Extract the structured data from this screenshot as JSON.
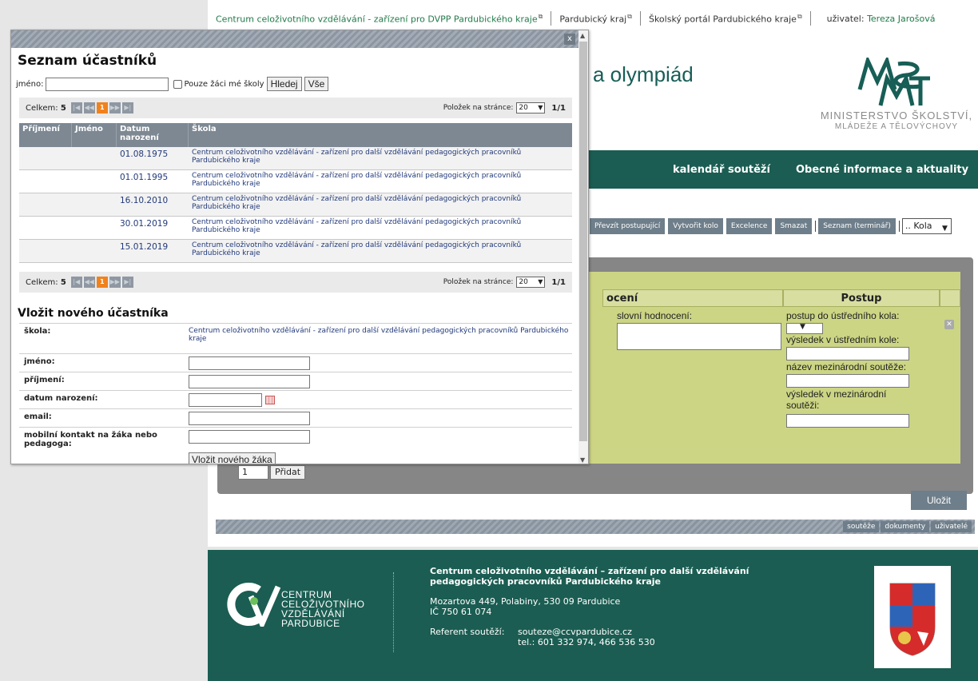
{
  "topbar": {
    "links": [
      {
        "label": "Centrum celoživotního vzdělávání - zařízení pro DVPP Pardubického kraje",
        "external": true
      },
      {
        "label": "Pardubický kraj",
        "external": true
      },
      {
        "label": "Školský portál Pardubického kraje",
        "external": true
      }
    ],
    "user_label": "uživatel:",
    "user_name": "Tereza Jarošová"
  },
  "header": {
    "title_fragment": "a olympiád",
    "ministry_line1": "MINISTERSTVO ŠKOLSTVÍ,",
    "ministry_line2": "MLÁDEŽE A TĚLOVÝCHOVY"
  },
  "nav": {
    "items": [
      "kalendář soutěží",
      "Obecné informace a aktuality"
    ]
  },
  "toolbar": {
    "buttons": [
      "Převzít postupující",
      "Vytvořit kolo",
      "Excelence",
      "Smazat",
      "Seznam (terminář)"
    ],
    "round_select": ".. Kola"
  },
  "result_panel": {
    "col_hodnoceni": "ocení",
    "col_postup": "Postup",
    "slovni_label": "slovní hodnocení:",
    "postup_label": "postup do ústředního kola:",
    "vysledek_ustredni_label": "výsledek v ústředním kole:",
    "nazev_mezinarodni_label": "název mezinárodní soutěže:",
    "vysledek_mezinarodni_label": "výsledek v mezinárodní soutěži:",
    "count_select": "1",
    "pridat_button": "Přidat",
    "save_button": "Uložit"
  },
  "bottombar": {
    "links": [
      "soutěže",
      "dokumenty",
      "uživatelé"
    ]
  },
  "footer": {
    "logo_lines": [
      "CENTRUM",
      "CELOŽIVOTNÍHO",
      "VZDĚLÁVÁNÍ",
      "PARDUBICE"
    ],
    "org_name": "Centrum celoživotního vzdělávání – zařízení pro další vzdělávání pedagogických pracovníků Pardubického kraje",
    "address": "Mozartova 449, Polabiny, 530 09 Pardubice",
    "ico": "IČ 750 61 074",
    "referent_label": "Referent soutěží:",
    "email": "souteze@ccvpardubice.cz",
    "phone": "tel.: 601 332 974, 466 536 530"
  },
  "modal": {
    "close_label": "x",
    "title": "Seznam účastníků",
    "filter": {
      "name_label": "jméno:",
      "name_value": "",
      "only_my_school_label": "Pouze žáci mé školy",
      "search_button": "Hledej",
      "all_button": "Vše"
    },
    "pager": {
      "total_label": "Celkem:",
      "total_value": "5",
      "current_page": "1",
      "per_page_label": "Položek na stránce:",
      "per_page_value": "20",
      "page_info": "1/1"
    },
    "table": {
      "headers": [
        "Příjmení",
        "Jméno",
        "Datum narození",
        "Škola"
      ],
      "rows": [
        {
          "prijmeni": "",
          "jmeno": "",
          "datum": "01.08.1975",
          "skola": "Centrum celoživotního vzdělávání - zařízení pro další vzdělávání pedagogických pracovníků Pardubického kraje"
        },
        {
          "prijmeni": "",
          "jmeno": "",
          "datum": "01.01.1995",
          "skola": "Centrum celoživotního vzdělávání - zařízení pro další vzdělávání pedagogických pracovníků Pardubického kraje"
        },
        {
          "prijmeni": "",
          "jmeno": "",
          "datum": "16.10.2010",
          "skola": "Centrum celoživotního vzdělávání - zařízení pro další vzdělávání pedagogických pracovníků Pardubického kraje"
        },
        {
          "prijmeni": "",
          "jmeno": "",
          "datum": "30.01.2019",
          "skola": "Centrum celoživotního vzdělávání - zařízení pro další vzdělávání pedagogických pracovníků Pardubického kraje"
        },
        {
          "prijmeni": "",
          "jmeno": "",
          "datum": "15.01.2019",
          "skola": "Centrum celoživotního vzdělávání - zařízení pro další vzdělávání pedagogických pracovníků Pardubického kraje"
        }
      ]
    },
    "new_participant": {
      "title": "Vložit nového účastníka",
      "skola_label": "škola:",
      "skola_value": "Centrum celoživotního vzdělávání - zařízení pro další vzdělávání pedagogických pracovníků Pardubického kraje",
      "jmeno_label": "jméno:",
      "prijmeni_label": "příjmení:",
      "datum_label": "datum narození:",
      "email_label": "email:",
      "kontakt_label": "mobilní kontakt na žáka nebo pedagoga:",
      "submit_button": "Vložit nového žáka"
    }
  },
  "colors": {
    "brand_green": "#1b5d52",
    "link_green": "#237a4a",
    "panel_olive": "#ccd584",
    "pager_active": "#f0821e"
  }
}
